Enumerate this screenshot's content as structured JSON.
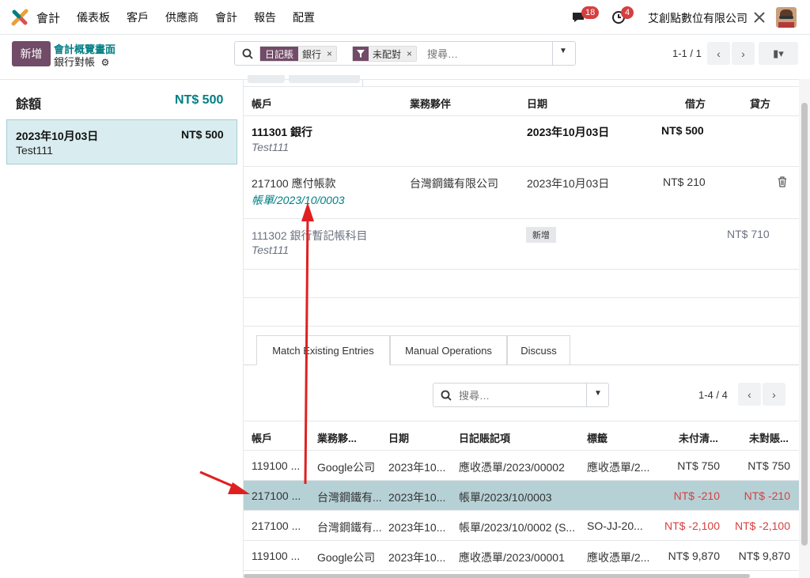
{
  "nav": {
    "app_name": "會計",
    "menu": [
      "儀表板",
      "客戶",
      "供應商",
      "會計",
      "報告",
      "配置"
    ],
    "messages_count": "18",
    "activities_count": "4",
    "company": "艾創點數位有限公司"
  },
  "control": {
    "new_label": "新增",
    "breadcrumb_parent": "會計概覽畫面",
    "breadcrumb_current": "銀行對帳",
    "search": {
      "facet1_tag": "日記賬",
      "facet1_value": "銀行",
      "facet2_value": "未配對",
      "placeholder": "搜尋…"
    },
    "pager": "1-1 / 1"
  },
  "left": {
    "balance_label": "餘額",
    "balance_amount": "NT$ 500",
    "statement_line": {
      "date": "2023年10月03日",
      "amount": "NT$ 500",
      "label": "Test111"
    }
  },
  "right": {
    "headers": {
      "account": "帳戶",
      "partner": "業務夥伴",
      "date": "日期",
      "debit": "借方",
      "credit": "貸方"
    },
    "lines": [
      {
        "account": "111301 銀行",
        "ref": "Test111",
        "partner": "",
        "date": "2023年10月03日",
        "debit": "NT$ 500",
        "credit": ""
      },
      {
        "account": "217100 應付帳款",
        "ref": "帳單/2023/10/0003",
        "partner": "台灣鋼鐵有限公司",
        "date": "2023年10月03日",
        "debit": "NT$ 210",
        "credit": ""
      },
      {
        "account": "111302 銀行暫記帳科目",
        "ref": "Test111",
        "partner": "",
        "date": "",
        "badge": "新增",
        "debit": "",
        "credit": "NT$ 710"
      }
    ]
  },
  "tabs": {
    "items": [
      "Match Existing Entries",
      "Manual Operations",
      "Discuss"
    ],
    "active": "Match Existing Entries"
  },
  "match": {
    "search_placeholder": "搜尋…",
    "pager": "1-4 / 4",
    "headers": {
      "account": "帳戶",
      "partner": "業務夥...",
      "date": "日期",
      "journal_item": "日記賬記項",
      "label": "標籤",
      "amount_residual": "未付清...",
      "amount_unreconciled": "未對賬..."
    },
    "rows": [
      {
        "account": "119100 ...",
        "partner": "Google公司",
        "date": "2023年10...",
        "journal_item": "應收憑單/2023/00002",
        "label": "應收憑單/2...",
        "amount_residual": "NT$ 750",
        "amount_unreconciled": "NT$ 750",
        "negative": false,
        "selected": false
      },
      {
        "account": "217100 ...",
        "partner": "台灣鋼鐵有...",
        "date": "2023年10...",
        "journal_item": "帳單/2023/10/0003",
        "label": "",
        "amount_residual": "NT$ -210",
        "amount_unreconciled": "NT$ -210",
        "negative": true,
        "selected": true
      },
      {
        "account": "217100 ...",
        "partner": "台灣鋼鐵有...",
        "date": "2023年10...",
        "journal_item": "帳單/2023/10/0002 (S...",
        "label": "SO-JJ-20...",
        "amount_residual": "NT$ -2,100",
        "amount_unreconciled": "NT$ -2,100",
        "negative": true,
        "selected": false
      },
      {
        "account": "119100 ...",
        "partner": "Google公司",
        "date": "2023年10...",
        "journal_item": "應收憑單/2023/00001",
        "label": "應收憑單/2...",
        "amount_residual": "NT$ 9,870",
        "amount_unreconciled": "NT$ 9,870",
        "negative": false,
        "selected": false
      }
    ]
  },
  "colors": {
    "brand": "#714b67",
    "teal": "#017e84",
    "selected_row": "#b6d1d6",
    "negative": "#d63f3f",
    "annotation_arrow": "#e02020"
  }
}
